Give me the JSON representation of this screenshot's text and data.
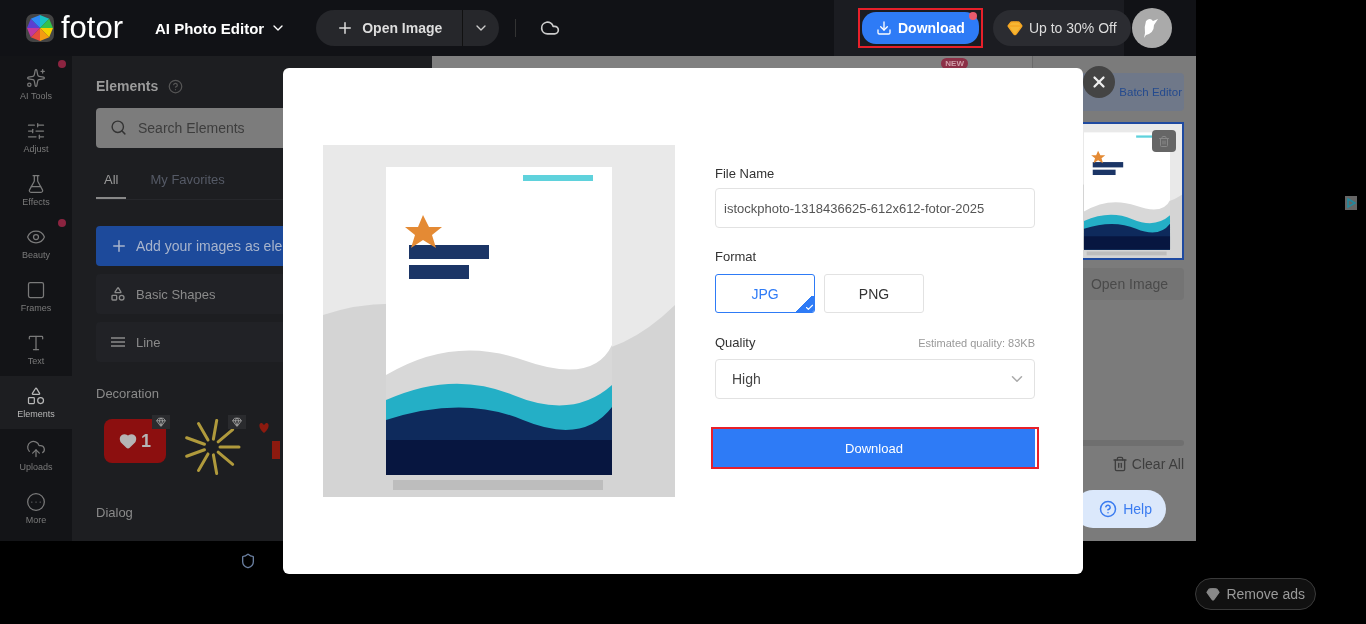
{
  "topbar": {
    "logo": "fotor",
    "product": "AI Photo Editor",
    "open_button": "Open Image",
    "download": {
      "label": "Download",
      "highlighted": true,
      "notification": true
    },
    "promo": "Up to 30% Off"
  },
  "rail": [
    {
      "kind": "sparkles",
      "label": "AI Tools",
      "dot": true,
      "selected": false
    },
    {
      "kind": "sliders",
      "label": "Adjust",
      "dot": false,
      "selected": false
    },
    {
      "kind": "flask",
      "label": "Effects",
      "dot": false,
      "selected": false
    },
    {
      "kind": "eye",
      "label": "Beauty",
      "dot": true,
      "selected": false
    },
    {
      "kind": "frame",
      "label": "Frames",
      "dot": false,
      "selected": false
    },
    {
      "kind": "text",
      "label": "Text",
      "dot": false,
      "selected": false
    },
    {
      "kind": "shapes",
      "label": "Elements",
      "dot": false,
      "selected": true
    },
    {
      "kind": "upload",
      "label": "Uploads",
      "dot": false,
      "selected": false
    },
    {
      "kind": "more",
      "label": "More",
      "dot": false,
      "selected": false
    }
  ],
  "panel": {
    "title": "Elements",
    "search_placeholder": "Search Elements",
    "tabs": [
      {
        "label": "All",
        "selected": true
      },
      {
        "label": "My Favorites",
        "selected": false
      }
    ],
    "add_button": "Add your images as ele",
    "categories": [
      {
        "kind": "shapes",
        "label": "Basic Shapes"
      },
      {
        "kind": "line",
        "label": "Line"
      }
    ],
    "decoration": {
      "title": "Decoration",
      "stickers": [
        {
          "kind": "like",
          "count": "1",
          "premium": true
        },
        {
          "kind": "firework",
          "premium": true
        },
        {
          "kind": "hearts",
          "premium": false
        }
      ]
    },
    "dialog_title": "Dialog"
  },
  "canvas": {
    "badge": "NEW"
  },
  "right_panel": {
    "batch_button": "Batch Editor",
    "thumbnail": {
      "kind": "picture",
      "selected": true
    },
    "open_button": "Open Image",
    "clear_button": "Clear All",
    "help_button": "Help"
  },
  "modal": {
    "preview": {
      "kind": "picture"
    },
    "file_name_label": "File Name",
    "file_name": "istockphoto-1318436625-612x612-fotor-2025",
    "format_label": "Format",
    "formats": [
      {
        "label": "JPG",
        "selected": true
      },
      {
        "label": "PNG",
        "selected": false
      }
    ],
    "quality_label": "Quality",
    "estimate": "Estimated quality: 83KB",
    "quality": "High",
    "download": {
      "label": "Download",
      "highlighted": true
    }
  },
  "footer": {
    "remove_ads": "Remove ads"
  }
}
